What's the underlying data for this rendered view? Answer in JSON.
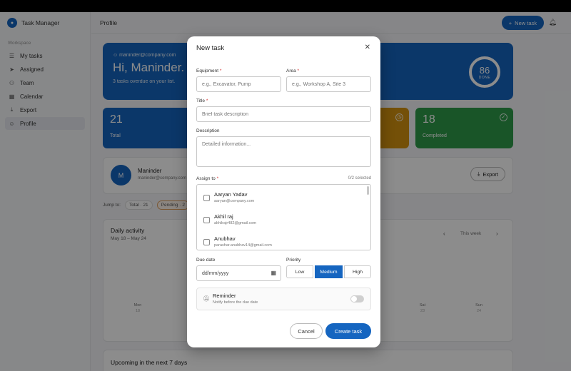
{
  "app": {
    "name": "Task Manager"
  },
  "sidebar": {
    "section_label": "Workspace",
    "items": [
      {
        "label": "My tasks",
        "icon": "list-icon"
      },
      {
        "label": "Assigned",
        "icon": "send-icon"
      },
      {
        "label": "Team",
        "icon": "team-icon"
      },
      {
        "label": "Calendar",
        "icon": "calendar-icon"
      },
      {
        "label": "Export",
        "icon": "download-icon"
      },
      {
        "label": "Profile",
        "icon": "user-icon",
        "active": true
      }
    ]
  },
  "header": {
    "title": "Profile",
    "new_task_label": "New task"
  },
  "hero": {
    "email": "maninder@company.com",
    "greeting": "Hi, Maninder.",
    "subtitle": "3 tasks overdue on your list.",
    "done_percent": "86",
    "done_label": "DONE"
  },
  "stats": [
    {
      "value": "21",
      "label": "Total",
      "color": "#1565c0"
    },
    {
      "value": "",
      "label": "",
      "color": "#d4920f"
    },
    {
      "value": "18",
      "label": "Completed",
      "color": "#2e9c4a"
    }
  ],
  "profile": {
    "initial": "M",
    "name": "Maninder",
    "email": "maninder@company.com",
    "export_label": "Export"
  },
  "jump": {
    "label": "Jump to:",
    "chips": [
      "Total · 21",
      "Pending · 2"
    ]
  },
  "activity": {
    "title": "Daily activity",
    "range": "May 18 – May 24",
    "period": "This week",
    "days": [
      {
        "name": "Mon",
        "num": "18"
      },
      {
        "name": "Sat",
        "num": "23"
      },
      {
        "name": "Sun",
        "num": "24"
      }
    ]
  },
  "upcoming": {
    "title": "Upcoming in the next 7 days"
  },
  "modal": {
    "title": "New task",
    "equipment": {
      "label": "Equipment",
      "placeholder": "e.g., Excavator, Pump"
    },
    "area": {
      "label": "Area",
      "placeholder": "e.g., Workshop A, Site 3"
    },
    "task_title": {
      "label": "Title",
      "placeholder": "Brief task description"
    },
    "description": {
      "label": "Description",
      "placeholder": "Detailed information..."
    },
    "assign": {
      "label": "Assign to",
      "selected": "0/2 selected",
      "people": [
        {
          "name": "Aaryan Yadav",
          "email": "aaryan@company.com"
        },
        {
          "name": "Akhil raj",
          "email": "akhilrajr482@gmail.com"
        },
        {
          "name": "Anubhav",
          "email": "parashar.anubhav14@gmail.com"
        }
      ]
    },
    "due_date": {
      "label": "Due date",
      "placeholder": "dd/mm/yyyy"
    },
    "priority": {
      "label": "Priority",
      "options": [
        "Low",
        "Medium",
        "High"
      ],
      "selected": "Medium"
    },
    "reminder": {
      "title": "Reminder",
      "subtitle": "Notify before the due date",
      "enabled": false
    },
    "cancel_label": "Cancel",
    "create_label": "Create task",
    "required_mark": "*"
  }
}
